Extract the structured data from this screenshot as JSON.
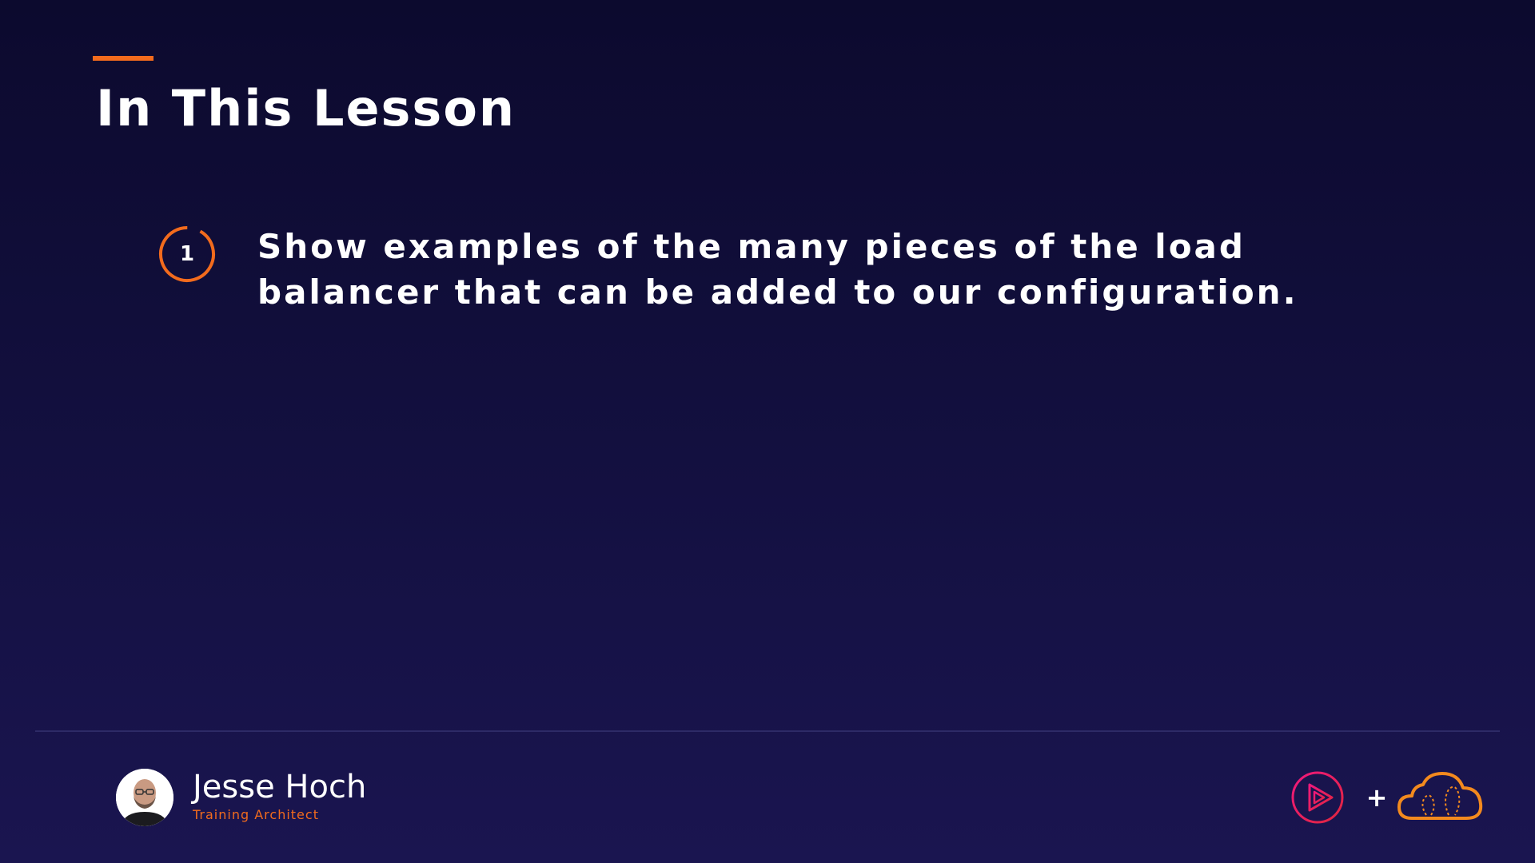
{
  "slide": {
    "title": "In This Lesson",
    "accent_color": "#f26b1d",
    "items": [
      {
        "number": "1",
        "text": "Show examples of the many pieces of the load balancer that can be added to our configuration."
      }
    ]
  },
  "presenter": {
    "name": "Jesse Hoch",
    "role": "Training Architect"
  },
  "logos": {
    "plus": "+",
    "left_icon": "pluralsight-play-icon",
    "right_icon": "acloudguru-cloud-icon"
  }
}
